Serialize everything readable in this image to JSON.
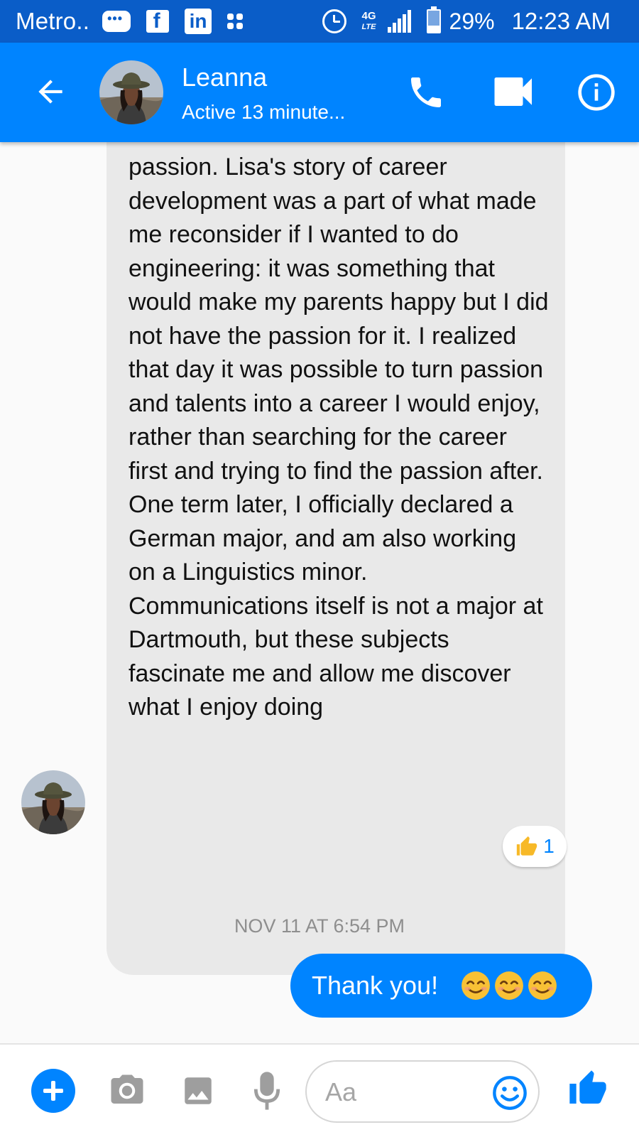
{
  "status_bar": {
    "carrier": "Metro..",
    "network": "4G",
    "network_sub": "LTE",
    "battery_percent": "29%",
    "battery_level": 0.29,
    "time": "12:23 AM",
    "icons": [
      "messages-icon",
      "facebook-icon",
      "linkedin-icon",
      "app-grid-icon",
      "alarm-icon",
      "signal-icon",
      "battery-icon"
    ]
  },
  "header": {
    "contact_name": "Leanna",
    "contact_status": "Active 13 minute...",
    "icons": [
      "back-arrow-icon",
      "phone-icon",
      "video-camera-icon",
      "info-icon"
    ]
  },
  "conversation": {
    "incoming_message": "passion. Lisa's story of career development was a part of what made me reconsider if I wanted to do engineering: it was something that would make my parents happy but I did not have the passion for it. I realized that day it was possible to turn passion and talents into a career I would enjoy, rather than searching for the career first and trying to find the passion after. One term later, I officially declared a German major, and am also working on a Linguistics minor. Communications itself is not a major at Dartmouth, but these subjects fascinate me and allow me discover what I enjoy doing",
    "reaction": {
      "icon": "thumbs-up-emoji",
      "count": "1"
    },
    "timestamp": "NOV 11 AT 6:54 PM",
    "outgoing_message": "Thank you!",
    "outgoing_emojis": [
      "smiling-face-emoji",
      "smiling-face-emoji",
      "smiling-face-emoji"
    ]
  },
  "composer": {
    "placeholder": "Aa",
    "value": "",
    "icons": [
      "plus-icon",
      "camera-icon",
      "image-icon",
      "microphone-icon",
      "emoji-icon",
      "like-icon"
    ]
  },
  "colors": {
    "status_bar": "#0a5dc8",
    "brand_blue": "#0084ff",
    "incoming_bubble": "#e9e9e9",
    "timestamp": "#8e8e8e",
    "composer_icons": "#9e9e9e"
  }
}
